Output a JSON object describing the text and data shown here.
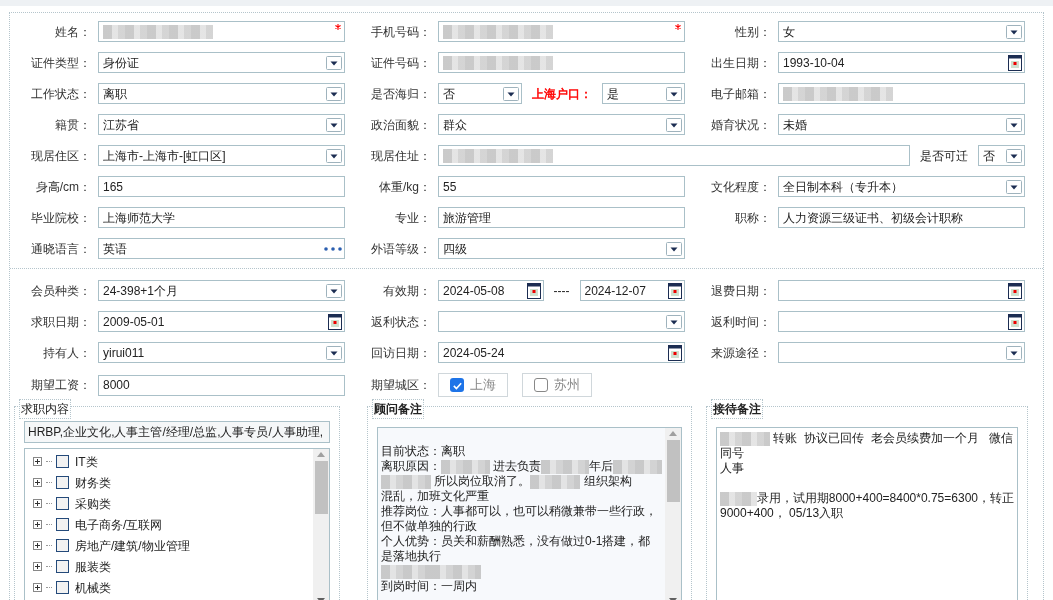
{
  "sections": [
    {
      "rows": [
        [
          {
            "label": "姓名：",
            "controls": [
              {
                "kind": "text",
                "redacted": true,
                "required": true
              }
            ]
          },
          {
            "label": "手机号码：",
            "controls": [
              {
                "kind": "text",
                "redacted": true,
                "required": true
              }
            ]
          },
          {
            "label": "性别：",
            "controls": [
              {
                "kind": "select",
                "value": "女"
              }
            ]
          }
        ],
        [
          {
            "label": "证件类型：",
            "controls": [
              {
                "kind": "select",
                "value": "身份证"
              }
            ]
          },
          {
            "label": "证件号码：",
            "controls": [
              {
                "kind": "text",
                "redacted": true
              }
            ]
          },
          {
            "label": "出生日期：",
            "controls": [
              {
                "kind": "date",
                "value": "1993-10-04"
              }
            ]
          }
        ],
        [
          {
            "label": "工作状态：",
            "controls": [
              {
                "kind": "select",
                "value": "离职"
              }
            ]
          },
          {
            "label": "是否海归：",
            "controls": [
              {
                "kind": "select",
                "value": "否"
              },
              {
                "kind": "label",
                "text": "上海户口：",
                "color": "#ff0000"
              },
              {
                "kind": "select",
                "value": "是"
              }
            ]
          },
          {
            "label": "电子邮箱：",
            "controls": [
              {
                "kind": "text",
                "redacted": true
              }
            ]
          }
        ],
        [
          {
            "label": "籍贯：",
            "controls": [
              {
                "kind": "select",
                "value": "江苏省"
              }
            ]
          },
          {
            "label": "政治面貌：",
            "controls": [
              {
                "kind": "select",
                "value": "群众"
              }
            ]
          },
          {
            "label": "婚育状况：",
            "controls": [
              {
                "kind": "select",
                "value": "未婚"
              }
            ]
          }
        ],
        [
          {
            "label": "现居住区：",
            "controls": [
              {
                "kind": "select",
                "value": "上海市-上海市-[虹口区]"
              }
            ]
          },
          {
            "label": "现居住址：",
            "controls": [
              {
                "kind": "text",
                "redacted": true
              },
              {
                "kind": "label",
                "text": "是否可迁"
              },
              {
                "kind": "select",
                "value": "否"
              }
            ]
          }
        ],
        [
          {
            "label": "身高/cm：",
            "controls": [
              {
                "kind": "text",
                "value": "165"
              }
            ]
          },
          {
            "label": "体重/kg：",
            "controls": [
              {
                "kind": "text",
                "value": "55"
              }
            ]
          },
          {
            "label": "文化程度：",
            "controls": [
              {
                "kind": "select",
                "value": "全日制本科（专升本）"
              }
            ]
          }
        ],
        [
          {
            "label": "毕业院校：",
            "controls": [
              {
                "kind": "text",
                "value": "上海师范大学"
              }
            ]
          },
          {
            "label": "专业：",
            "controls": [
              {
                "kind": "text",
                "value": "旅游管理"
              }
            ]
          },
          {
            "label": "职称：",
            "controls": [
              {
                "kind": "text",
                "value": "人力资源三级证书、初级会计职称"
              }
            ]
          }
        ],
        [
          {
            "label": "通晓语言：",
            "controls": [
              {
                "kind": "lookup",
                "value": "英语"
              }
            ]
          },
          {
            "label": "外语等级：",
            "controls": [
              {
                "kind": "select",
                "value": "四级"
              }
            ]
          }
        ]
      ]
    },
    {
      "rows": [
        [
          {
            "label": "会员种类：",
            "controls": [
              {
                "kind": "select",
                "value": "24-398+1个月"
              }
            ]
          },
          {
            "label": "有效期：",
            "controls": [
              {
                "kind": "date",
                "value": "2024-05-08"
              },
              {
                "kind": "label",
                "text": "----"
              },
              {
                "kind": "date",
                "value": "2024-12-07"
              }
            ]
          },
          {
            "label": "退费日期：",
            "controls": [
              {
                "kind": "date"
              }
            ]
          }
        ],
        [
          {
            "label": "求职日期：",
            "controls": [
              {
                "kind": "date",
                "value": "2009-05-01"
              }
            ]
          },
          {
            "label": "返利状态：",
            "controls": [
              {
                "kind": "select"
              }
            ]
          },
          {
            "label": "返利时间：",
            "controls": [
              {
                "kind": "date"
              }
            ]
          }
        ],
        [
          {
            "label": "持有人：",
            "controls": [
              {
                "kind": "select",
                "value": "yirui011"
              }
            ]
          },
          {
            "label": "回访日期：",
            "controls": [
              {
                "kind": "date",
                "value": "2024-05-24"
              }
            ]
          },
          {
            "label": "来源途径：",
            "controls": [
              {
                "kind": "select"
              }
            ]
          }
        ],
        [
          {
            "label": "期望工资：",
            "controls": [
              {
                "kind": "text",
                "value": "8000"
              }
            ]
          },
          {
            "label": "期望城区：",
            "controls": [
              {
                "kind": "check",
                "label": "上海",
                "checked": true
              },
              {
                "kind": "check",
                "label": "苏州",
                "checked": false
              }
            ]
          }
        ]
      ]
    }
  ],
  "job_panel": {
    "title": "求职内容",
    "selected_text": "HRBP,企业文化,人事主管/经理/总监,人事专员/人事助理,",
    "tree": [
      {
        "label": "IT类",
        "checked": false,
        "expanded": false
      },
      {
        "label": "财务类",
        "checked": false,
        "expanded": false
      },
      {
        "label": "采购类",
        "checked": false,
        "expanded": false
      },
      {
        "label": "电子商务/互联网",
        "checked": false,
        "expanded": false
      },
      {
        "label": "房地产/建筑/物业管理",
        "checked": false,
        "expanded": false
      },
      {
        "label": "服装类",
        "checked": false,
        "expanded": false
      },
      {
        "label": "机械类",
        "checked": false,
        "expanded": false
      }
    ]
  },
  "advisor_notes": {
    "title": "顾问备注",
    "lines": [
      [
        "目前状态：离职"
      ],
      [
        "离职原因：",
        {
          "kind": "blur"
        },
        " 进去负责",
        {
          "kind": "blur"
        },
        "年后",
        {
          "kind": "blur"
        }
      ],
      [
        {
          "kind": "blur"
        },
        " 所以岗位取消了。",
        {
          "kind": "blur"
        },
        " 组织架构"
      ],
      [
        "混乱，加班文化严重"
      ],
      [
        "推荐岗位：人事都可以，也可以稍微兼带一些行政，"
      ],
      [
        "但不做单独的行政"
      ],
      [
        "个人优势：员关和薪酬熟悉，没有做过0-1搭建，都"
      ],
      [
        "是落地执行"
      ],
      [
        {
          "kind": "blur"
        },
        {
          "kind": "blur"
        }
      ],
      [
        "到岗时间：一周内"
      ]
    ]
  },
  "reception_notes": {
    "title": "接待备注",
    "lines": [
      [
        {
          "kind": "blur"
        },
        " 转账  协议已回传  老会员续费加一个月   微信"
      ],
      [
        "同号"
      ],
      [
        "人事"
      ],
      [
        {
          "kind": "blank"
        }
      ],
      [
        {
          "kind": "blur"
        },
        "录用，试用期8000+400=8400*0.75=6300，转正"
      ],
      [
        "9000+400，   05/13入职"
      ]
    ]
  }
}
